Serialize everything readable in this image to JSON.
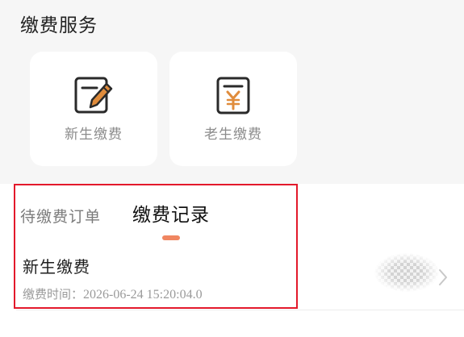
{
  "header": {
    "title": "缴费服务"
  },
  "services": [
    {
      "label": "新生缴费",
      "icon": "edit-document-icon"
    },
    {
      "label": "老生缴费",
      "icon": "yuan-document-icon"
    }
  ],
  "tabs": {
    "pending": "待缴费订单",
    "records": "缴费记录",
    "active": "records"
  },
  "records": [
    {
      "title": "新生缴费",
      "time_label": "缴费时间：",
      "time_value": "2026-06-24 15:20:04.0"
    }
  ],
  "colors": {
    "accent": "#f08661",
    "highlight": "#e3192b",
    "page_bg": "#f6f6f6",
    "card_bg": "#ffffff"
  }
}
